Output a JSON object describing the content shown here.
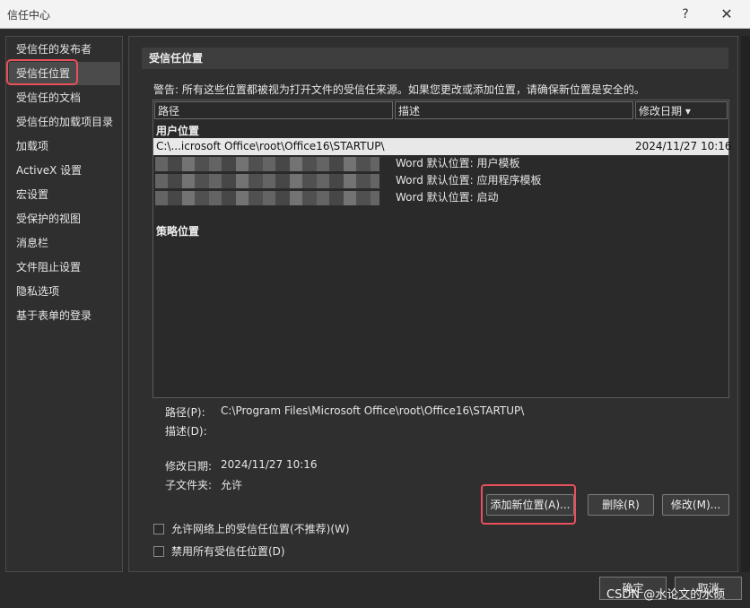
{
  "window": {
    "title": "信任中心",
    "help": "?",
    "close": "✕"
  },
  "sidebar": {
    "items": [
      {
        "label": "受信任的发布者"
      },
      {
        "label": "受信任位置"
      },
      {
        "label": "受信任的文档"
      },
      {
        "label": "受信任的加载项目录"
      },
      {
        "label": "加载项"
      },
      {
        "label": "ActiveX 设置"
      },
      {
        "label": "宏设置"
      },
      {
        "label": "受保护的视图"
      },
      {
        "label": "消息栏"
      },
      {
        "label": "文件阻止设置"
      },
      {
        "label": "隐私选项"
      },
      {
        "label": "基于表单的登录"
      }
    ],
    "selected_label": "受信任位置"
  },
  "main": {
    "section_title": "受信任位置",
    "warning": "警告: 所有这些位置都被视为打开文件的受信任来源。如果您更改或添加位置，请确保新位置是安全的。",
    "list": {
      "columns": [
        "路径",
        "描述",
        "修改日期 ▾"
      ],
      "user_group_title": "用户位置",
      "policy_group_title": "策略位置",
      "rows": [
        {
          "path": "C:\\...icrosoft Office\\root\\Office16\\STARTUP\\",
          "desc": "",
          "date": "2024/11/27 10:16"
        },
        {
          "path": "",
          "desc": "Word 默认位置: 用户模板",
          "date": ""
        },
        {
          "path": "",
          "desc": "Word 默认位置: 应用程序模板",
          "date": ""
        },
        {
          "path": "",
          "desc": "Word 默认位置: 启动",
          "date": ""
        }
      ]
    },
    "details": {
      "path_label": "路径(P):",
      "path_value": "C:\\Program Files\\Microsoft Office\\root\\Office16\\STARTUP\\",
      "desc_label": "描述(D):",
      "date_label": "修改日期:",
      "date_value": "2024/11/27 10:16",
      "subfolder_label": "子文件夹:",
      "subfolder_value": "允许"
    },
    "buttons": {
      "add": "添加新位置(A)...",
      "remove": "删除(R)",
      "modify": "修改(M)..."
    },
    "checkboxes": {
      "allow_network": "允许网络上的受信任位置(不推荐)(W)",
      "disable_all": "禁用所有受信任位置(D)"
    }
  },
  "footer": {
    "ok": "确定",
    "cancel": "取消"
  },
  "watermark": "CSDN @水论文的水硕",
  "colors": {
    "background": "#2b2b2b",
    "highlight_box": "#e8505b",
    "selected_row": "#e8e8e8"
  }
}
